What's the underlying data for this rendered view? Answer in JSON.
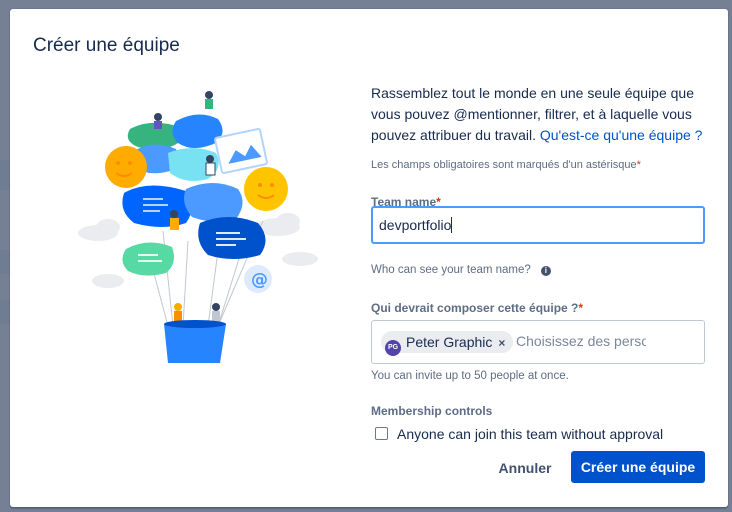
{
  "modal": {
    "title": "Créer une équipe",
    "intro_text": "Rassemblez tout le monde en une seule équipe que vous pouvez @mentionner, filtrer, et à laquelle vous pouvez attribuer du travail. ",
    "intro_link": "Qu'est-ce qu'une équipe ?",
    "required_note": "Les champs obligatoires sont marqués d'un astérisque",
    "required_asterisk": "*"
  },
  "team_name": {
    "label": "Team name",
    "value": "devportfolio",
    "helper": "Who can see your team name?"
  },
  "members": {
    "label": "Qui devrait composer cette équipe ?",
    "chip_initials": "PG",
    "chip_name": "Peter Graphic",
    "chip_remove": "×",
    "placeholder": "Choisissez des personnes",
    "helper": "You can invite up to 50 people at once."
  },
  "membership": {
    "label": "Membership controls",
    "checkbox_label": "Anyone can join this team without approval",
    "checked": false
  },
  "footer": {
    "cancel_label": "Annuler",
    "create_label": "Créer une équipe"
  },
  "colors": {
    "primary": "#0052cc",
    "focus_border": "#4c9aff",
    "required": "#de350b",
    "avatar": "#5243aa"
  }
}
